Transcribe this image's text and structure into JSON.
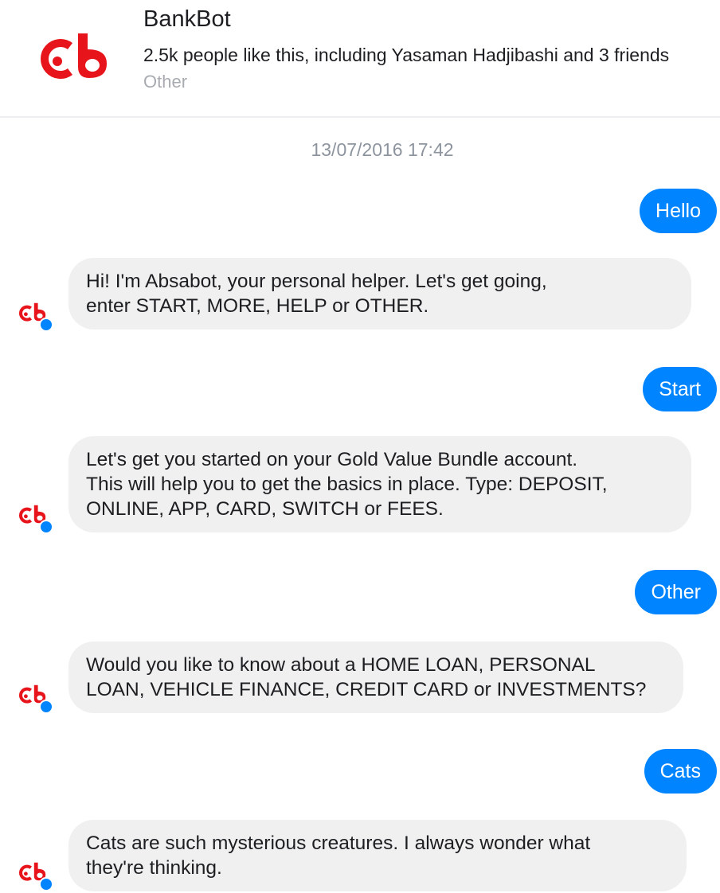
{
  "page": {
    "name": "BankBot",
    "likes": "2.5k people like this, including Yasaman Hadjibashi and 3 friends",
    "category": "Other",
    "logo_icon": "bank-logo-icon",
    "brand_color": "#e8141b"
  },
  "conversation": {
    "timestamp": "13/07/2016 17:42",
    "messages": [
      {
        "from": "user",
        "lines": [
          "Hello"
        ]
      },
      {
        "from": "bot",
        "lines": [
          "Hi! I'm Absabot, your personal helper. Let's get going,",
          "enter START, MORE, HELP or OTHER."
        ]
      },
      {
        "from": "user",
        "lines": [
          "Start"
        ]
      },
      {
        "from": "bot",
        "lines": [
          "Let's get you started on your Gold Value Bundle account.",
          "This will help you to get the basics in place. Type: DEPOSIT,",
          "ONLINE, APP, CARD, SWITCH or FEES."
        ]
      },
      {
        "from": "user",
        "lines": [
          "Other"
        ]
      },
      {
        "from": "bot",
        "lines": [
          "Would you like to know about a HOME LOAN, PERSONAL",
          "LOAN, VEHICLE FINANCE, CREDIT CARD or INVESTMENTS?"
        ]
      },
      {
        "from": "user",
        "lines": [
          "Cats"
        ]
      },
      {
        "from": "bot",
        "lines": [
          "Cats are such mysterious creatures. I always wonder what",
          "they're thinking."
        ]
      }
    ]
  },
  "colors": {
    "outgoing_bubble": "#0084ff",
    "incoming_bubble": "#f1f0f0",
    "timestamp_text": "#8d949e",
    "category_text": "#a8abb0"
  }
}
